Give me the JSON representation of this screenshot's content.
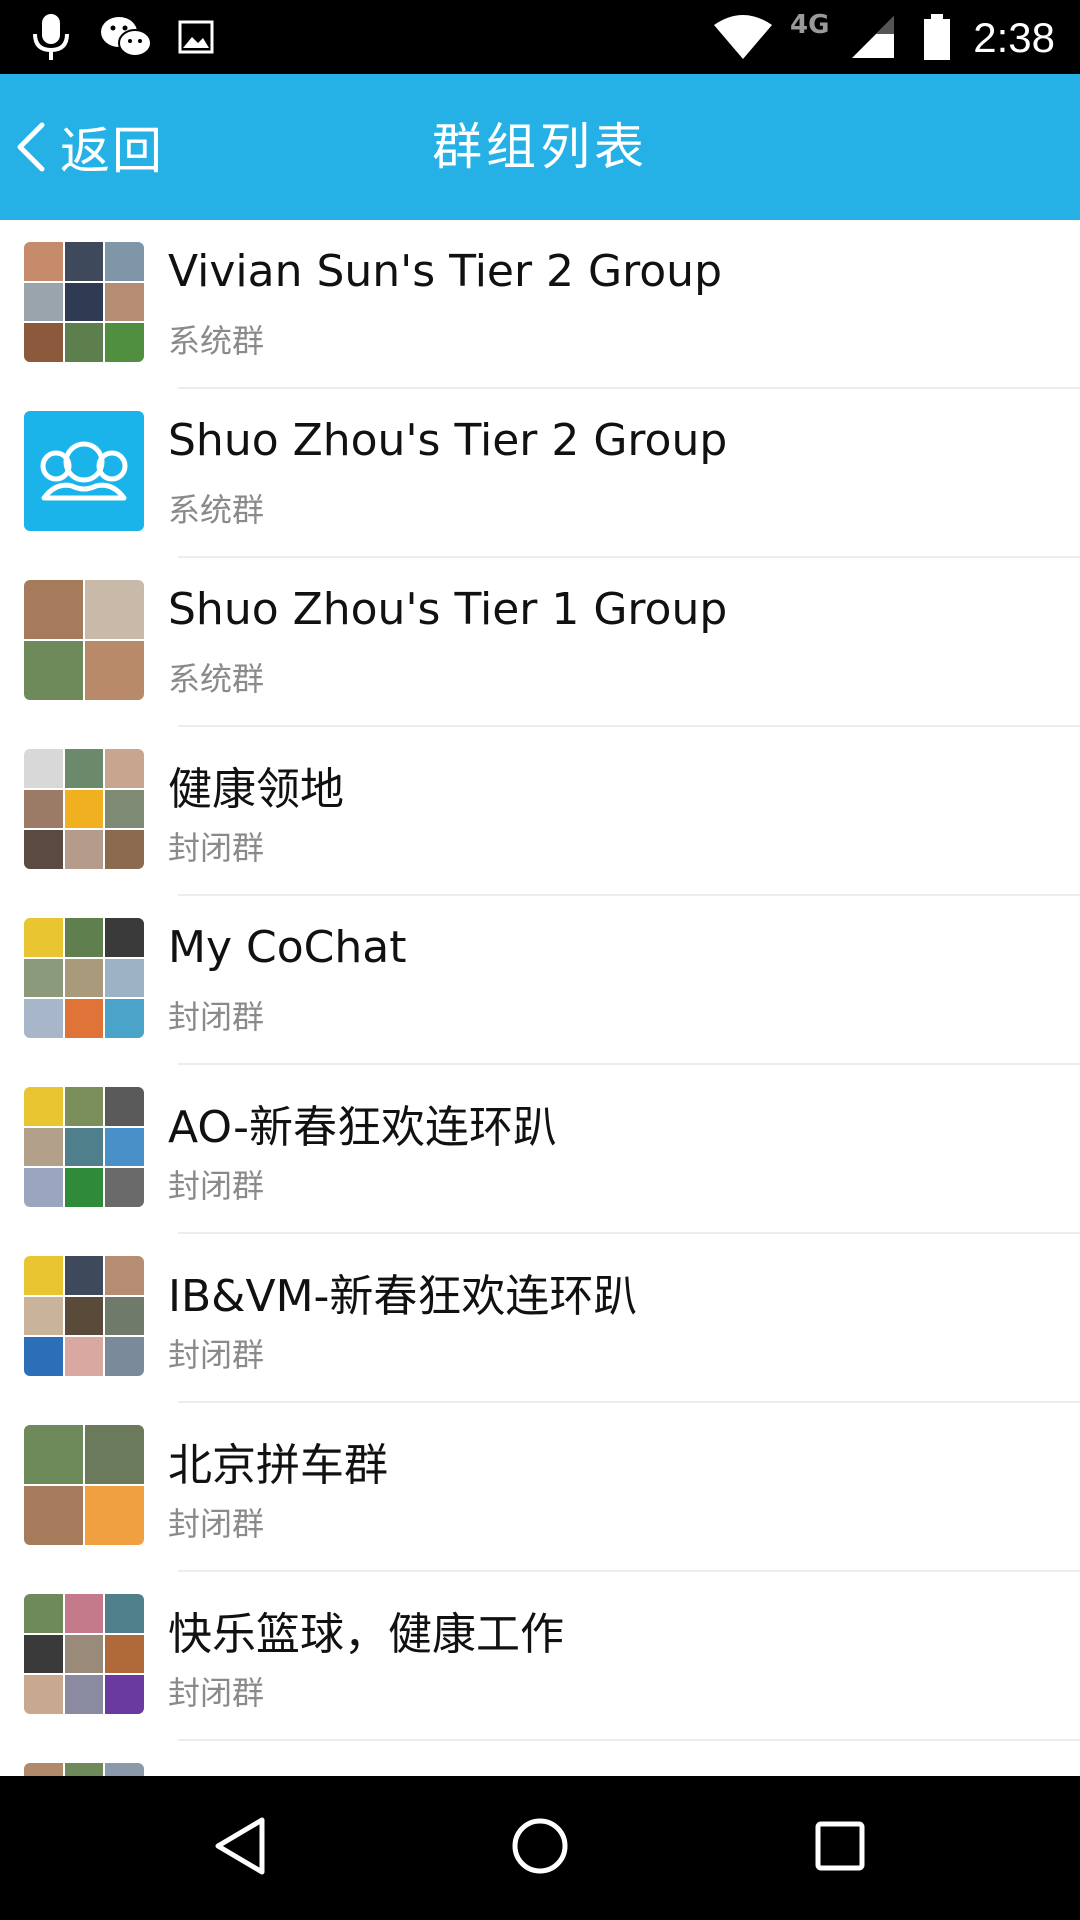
{
  "status_bar": {
    "time": "2:38",
    "network": "4G",
    "icons": [
      "mic-icon",
      "wechat-icon",
      "image-icon",
      "wifi-icon",
      "signal-icon",
      "battery-icon"
    ]
  },
  "header": {
    "back_label": "返回",
    "title": "群组列表",
    "background_color": "#25b1e6"
  },
  "groups": [
    {
      "name": "Vivian Sun's Tier 2 Group",
      "type": "系统群",
      "avatar": "grid-3x3"
    },
    {
      "name": "Shuo Zhou's Tier 2 Group",
      "type": "系统群",
      "avatar": "default-group-icon"
    },
    {
      "name": "Shuo Zhou's Tier 1 Group",
      "type": "系统群",
      "avatar": "grid-2x2"
    },
    {
      "name": "健康领地",
      "type": "封闭群",
      "avatar": "grid-3x3"
    },
    {
      "name": "My CoChat",
      "type": "封闭群",
      "avatar": "grid-3x3"
    },
    {
      "name": "AO-新春狂欢连环趴",
      "type": "封闭群",
      "avatar": "grid-3x3"
    },
    {
      "name": "IB&VM-新春狂欢连环趴",
      "type": "封闭群",
      "avatar": "grid-3x3"
    },
    {
      "name": "北京拼车群",
      "type": "封闭群",
      "avatar": "grid-2x2"
    },
    {
      "name": "快乐篮球，健康工作",
      "type": "封闭群",
      "avatar": "grid-3x3"
    }
  ],
  "nav_bar": {
    "buttons": [
      "back-triangle-icon",
      "home-circle-icon",
      "recents-square-icon"
    ]
  }
}
